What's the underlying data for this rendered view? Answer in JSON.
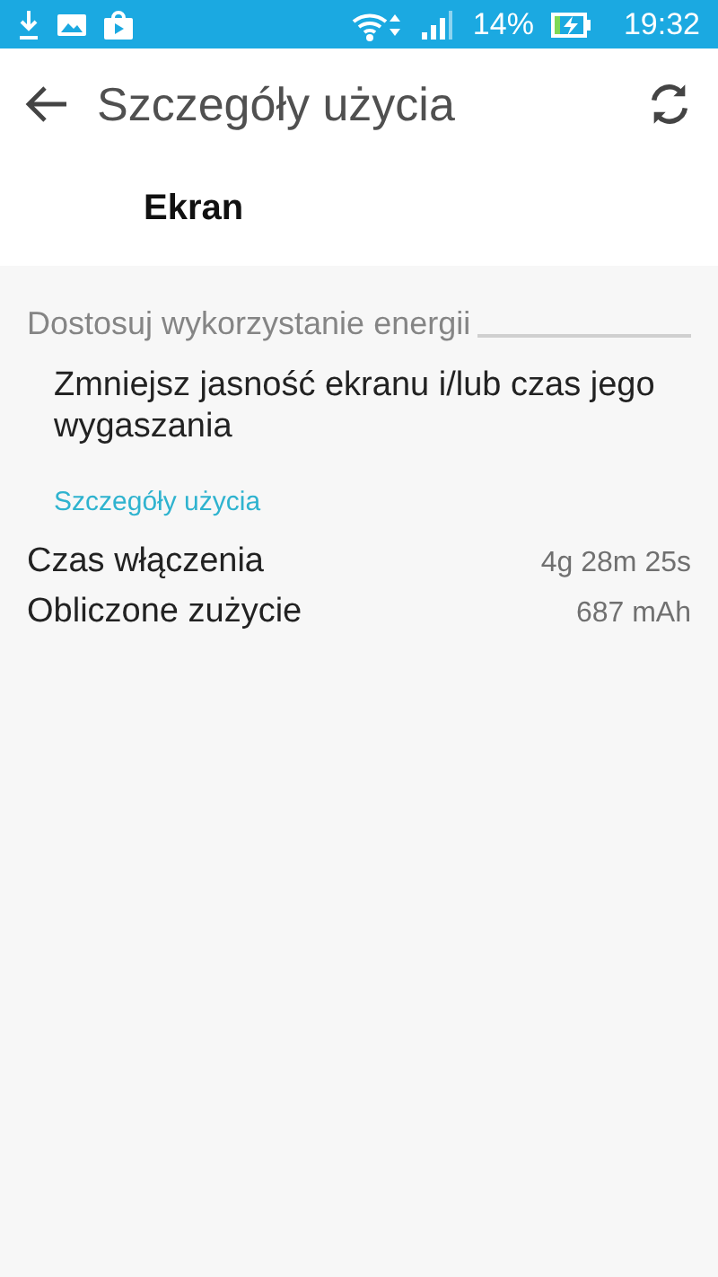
{
  "status_bar": {
    "battery": "14%",
    "time": "19:32"
  },
  "app_bar": {
    "title": "Szczegóły użycia"
  },
  "app_name": "Ekran",
  "section": {
    "title": "Dostosuj wykorzystanie energii",
    "description": "Zmniejsz jasność ekranu i/lub czas jego wygaszania"
  },
  "details": {
    "title": "Szczegóły użycia",
    "rows": [
      {
        "label": "Czas włączenia",
        "value": "4g 28m 25s"
      },
      {
        "label": "Obliczone zużycie",
        "value": "687 mAh"
      }
    ]
  }
}
